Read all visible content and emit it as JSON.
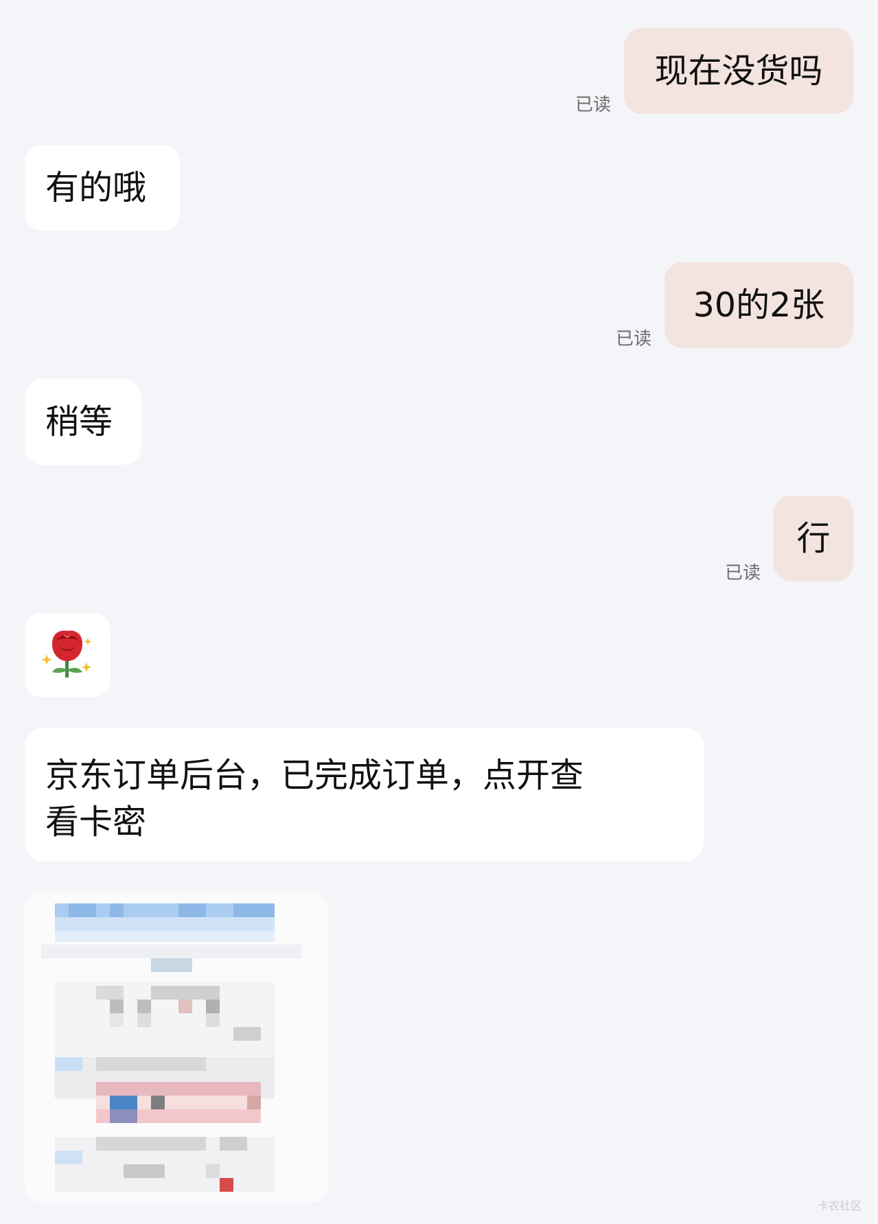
{
  "messages": [
    {
      "side": "out",
      "text": "现在没货吗",
      "status": "已读"
    },
    {
      "side": "in",
      "text": "有的哦"
    },
    {
      "side": "out",
      "text": "30的2张",
      "status": "已读"
    },
    {
      "side": "in",
      "text": "稍等"
    },
    {
      "side": "out",
      "text": "行",
      "status": "已读"
    },
    {
      "side": "in",
      "emoji": "rose-sparkle-emoji"
    },
    {
      "side": "in",
      "text_line1": "京东订单后台，已完成订单，点开查",
      "text_line2": "看卡密"
    },
    {
      "side": "in",
      "image": "pixelated-screenshot"
    }
  ],
  "watermark": "卡农社区",
  "colors": {
    "background": "#f4f5f9",
    "outgoing": "#f3e4df",
    "incoming": "#ffffff"
  }
}
